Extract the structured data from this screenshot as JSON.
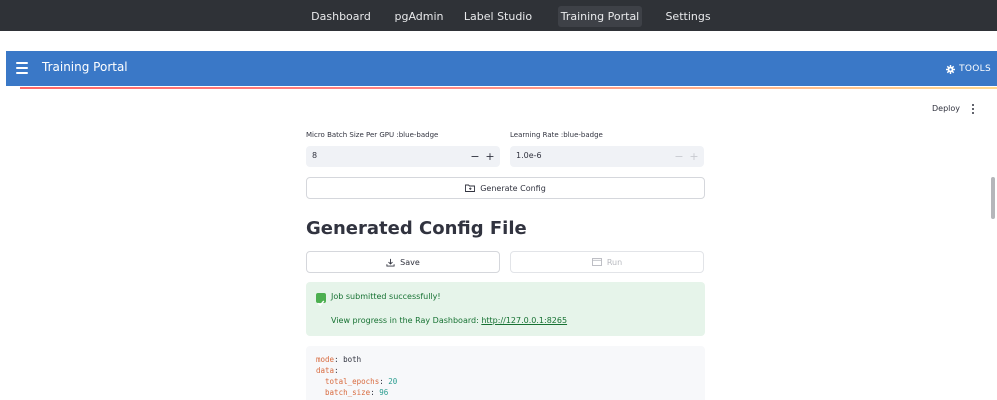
{
  "topnav": {
    "items": [
      {
        "label": "Dashboard"
      },
      {
        "label": "pgAdmin"
      },
      {
        "label": "Label Studio"
      },
      {
        "label": "Training Portal",
        "active": true
      },
      {
        "label": "Settings"
      }
    ]
  },
  "appbar": {
    "title": "Training Portal",
    "tools_label": "TOOLS",
    "color": "#3a78c7"
  },
  "header": {
    "deploy_label": "Deploy"
  },
  "form": {
    "micro_batch": {
      "label": "Micro Batch Size Per GPU :blue-badge",
      "value": "8"
    },
    "learning_rate": {
      "label": "Learning Rate :blue-badge",
      "value": "1.0e-6"
    },
    "generate_label": "Generate Config"
  },
  "config": {
    "heading": "Generated Config File",
    "save_label": "Save",
    "run_label": "Run"
  },
  "alert": {
    "message": "Job submitted successfully!",
    "progress_prefix": "View progress in the Ray Dashboard:",
    "progress_link": "http://127.0.0.1:8265"
  },
  "code": {
    "l1_key": "mode",
    "l1_val": "both",
    "l2_key": "data",
    "l3_key": "total_epochs",
    "l3_val": "20",
    "l4_key": "batch_size",
    "l4_val": "96"
  },
  "icons": {
    "menu": "hamburger-icon",
    "tools": "gear-icon",
    "generate": "folder-icon",
    "save": "download-icon",
    "run": "terminal-icon",
    "success": "checkbox-check-icon"
  }
}
